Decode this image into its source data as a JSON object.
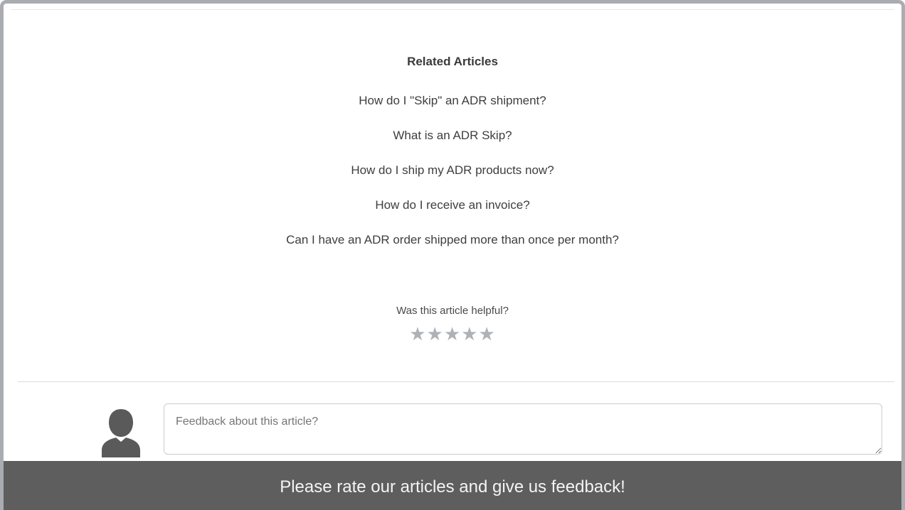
{
  "related": {
    "title": "Related Articles",
    "articles": [
      "How do I \"Skip\" an ADR shipment?",
      "What is an ADR Skip?",
      "How do I ship my ADR products now?",
      "How do I receive an invoice?",
      "Can I have an ADR order shipped more than once per month?"
    ]
  },
  "rating": {
    "question": "Was this article helpful?",
    "max_stars": 5,
    "current_rating": 0,
    "star_color": "#aeb2b6",
    "star_icon": "star-icon"
  },
  "feedback": {
    "placeholder": "Feedback about this article?",
    "value": "",
    "avatar_icon": "user-avatar-icon",
    "avatar_color": "#5a5a5a"
  },
  "banner": {
    "text": "Please rate our articles and give us feedback!",
    "background": "#5e5e5e"
  }
}
